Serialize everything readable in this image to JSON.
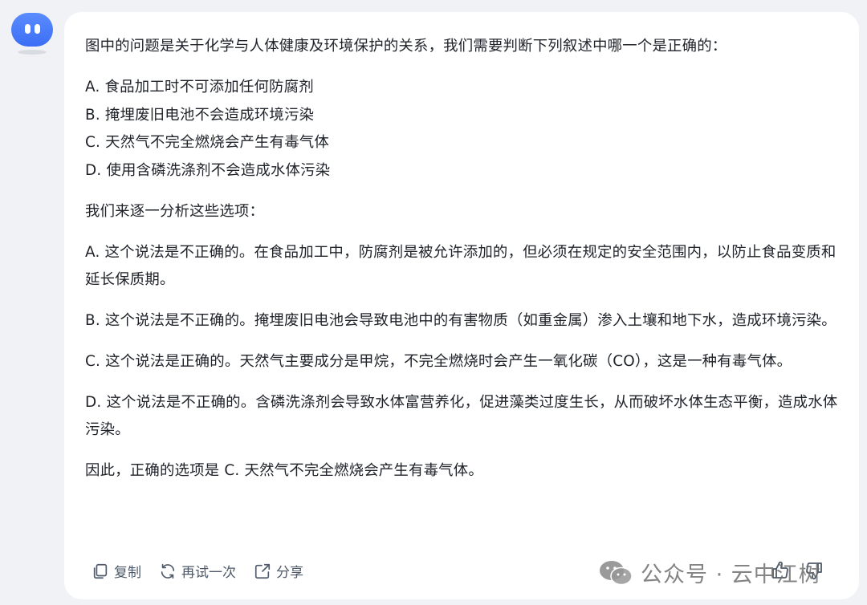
{
  "message": {
    "intro": "图中的问题是关于化学与人体健康及环境保护的关系，我们需要判断下列叙述中哪一个是正确的：",
    "options": [
      "A. 食品加工时不可添加任何防腐剂",
      "B. 掩埋废旧电池不会造成环境污染",
      "C. 天然气不完全燃烧会产生有毒气体",
      "D. 使用含磷洗涤剂不会造成水体污染"
    ],
    "lead": "我们来逐一分析这些选项：",
    "analysis": [
      "A. 这个说法是不正确的。在食品加工中，防腐剂是被允许添加的，但必须在规定的安全范围内，以防止食品变质和延长保质期。",
      "B. 这个说法是不正确的。掩埋废旧电池会导致电池中的有害物质（如重金属）渗入土壤和地下水，造成环境污染。",
      "C. 这个说法是正确的。天然气主要成分是甲烷，不完全燃烧时会产生一氧化碳（CO），这是一种有毒气体。",
      "D. 这个说法是不正确的。含磷洗涤剂会导致水体富营养化，促进藻类过度生长，从而破坏水体生态平衡，造成水体污染。"
    ],
    "conclusion": "因此，正确的选项是 C. 天然气不完全燃烧会产生有毒气体。"
  },
  "toolbar": {
    "copy_label": "复制",
    "retry_label": "再试一次",
    "share_label": "分享"
  },
  "watermark": {
    "text": "公众号 · 云中江树"
  },
  "icons": {
    "avatar": "robot-avatar-icon",
    "copy": "copy-icon",
    "retry": "refresh-icon",
    "share": "share-icon",
    "thumbs_up": "thumbs-up-icon",
    "thumbs_down": "thumbs-down-icon",
    "wechat": "wechat-icon"
  },
  "colors": {
    "accent": "#3b6ef5",
    "background": "#f1f2f6",
    "card": "#ffffff",
    "text": "#1f2329",
    "muted": "#4e5969"
  }
}
